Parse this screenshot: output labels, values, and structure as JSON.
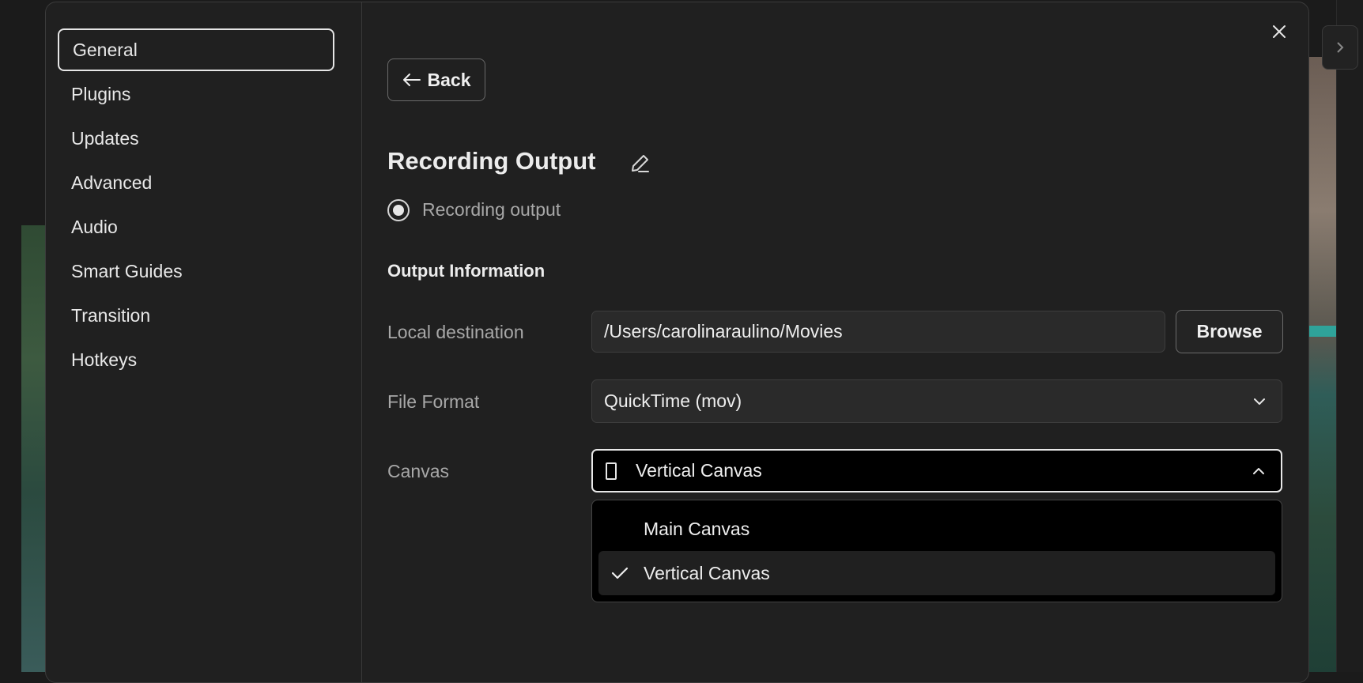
{
  "sidebar": {
    "items": [
      {
        "label": "General",
        "active": true
      },
      {
        "label": "Plugins"
      },
      {
        "label": "Updates"
      },
      {
        "label": "Advanced"
      },
      {
        "label": "Audio"
      },
      {
        "label": "Smart Guides"
      },
      {
        "label": "Transition"
      },
      {
        "label": "Hotkeys"
      }
    ]
  },
  "main": {
    "back_label": "Back",
    "title": "Recording Output",
    "radio_label": "Recording output",
    "section_title": "Output Information",
    "fields": {
      "local_destination": {
        "label": "Local destination",
        "value": "/Users/carolinaraulino/Movies",
        "button": "Browse"
      },
      "file_format": {
        "label": "File Format",
        "value": "QuickTime (mov)"
      },
      "canvas": {
        "label": "Canvas",
        "value": "Vertical Canvas"
      }
    },
    "canvas_options": [
      {
        "label": "Main Canvas",
        "selected": false
      },
      {
        "label": "Vertical Canvas",
        "selected": true
      }
    ]
  },
  "icons": {
    "close": "close-icon",
    "back": "arrow-left-icon",
    "edit": "pencil-icon",
    "chevron_down": "chevron-down-icon",
    "chevron_up": "chevron-up-icon",
    "phone": "vertical-canvas-icon",
    "check": "check-icon",
    "side_toggle": "chevron-right-icon"
  },
  "colors": {
    "background": "#202020",
    "border": "#3b3b3b",
    "accent_text": "#e6e6e6",
    "muted_text": "#a8a8a8"
  }
}
